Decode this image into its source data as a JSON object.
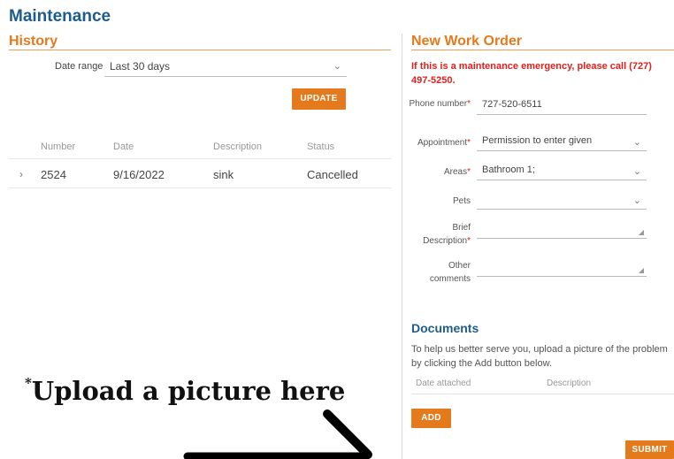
{
  "page": {
    "title": "Maintenance"
  },
  "history": {
    "title": "History",
    "date_range_label": "Date range",
    "date_range_value": "Last 30 days",
    "update_label": "UPDATE",
    "columns": [
      "Number",
      "Date",
      "Description",
      "Status"
    ],
    "rows": [
      {
        "number": "2524",
        "date": "9/16/2022",
        "description": "sink",
        "status": "Cancelled"
      }
    ]
  },
  "work_order": {
    "title": "New Work Order",
    "emergency_notice": "If this is a maintenance emergency, please call (727) 497-5250.",
    "phone_label": "Phone number",
    "phone_value": "727-520-6511",
    "appointment_label": "Appointment",
    "appointment_value": "Permission to enter given",
    "areas_label": "Areas",
    "areas_value": "Bathroom 1;",
    "pets_label": "Pets",
    "pets_value": "",
    "brief_label": "Brief Description",
    "other_label": "Other comments",
    "required_mark": "*"
  },
  "documents": {
    "title": "Documents",
    "help_text": "To help us better serve you, upload a picture of the problem by clicking the Add button below.",
    "columns": [
      "Date attached",
      "Description"
    ],
    "add_label": "ADD",
    "submit_label": "SUBMIT"
  },
  "annotation": {
    "mark": "*",
    "text": "Upload a picture here"
  },
  "colors": {
    "brand_blue": "#1d5c8c",
    "accent_orange": "#e57a1c",
    "alert_red": "#e0201b"
  }
}
